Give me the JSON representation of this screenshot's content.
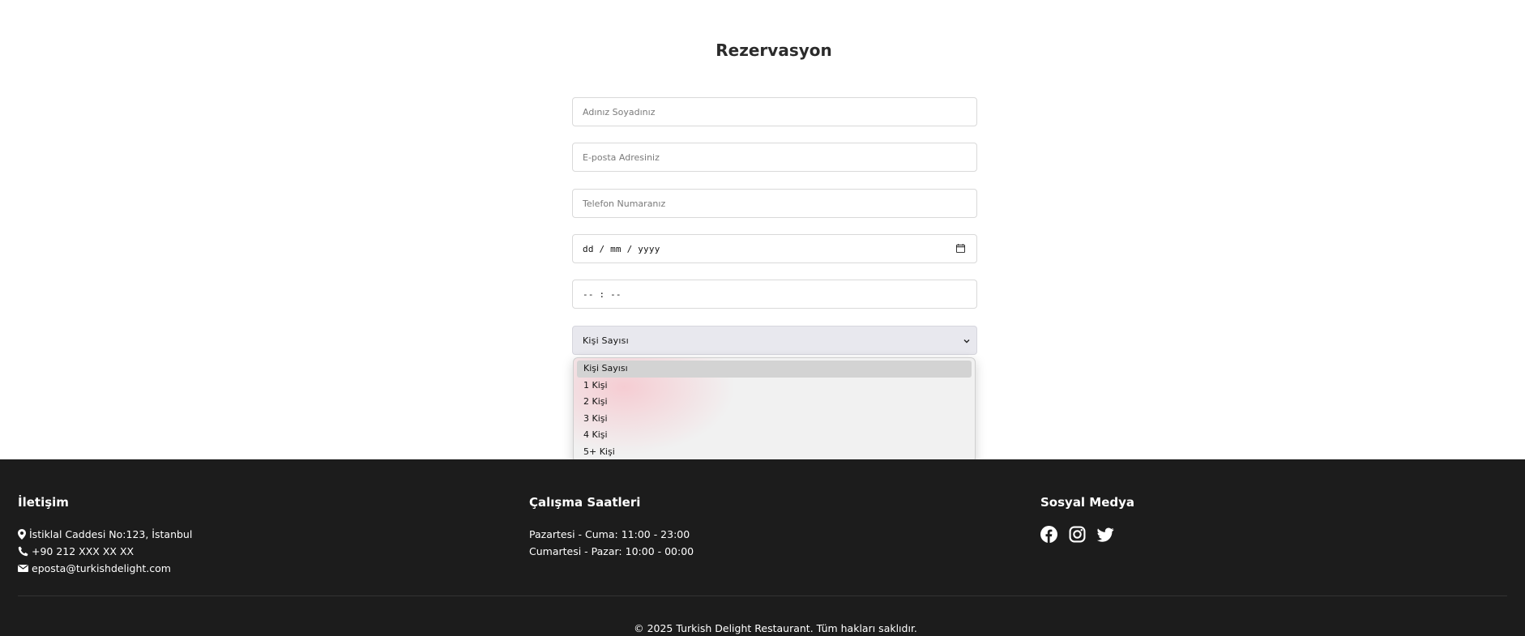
{
  "reservation": {
    "title": "Rezervasyon",
    "name_placeholder": "Adınız Soyadınız",
    "email_placeholder": "E-posta Adresiniz",
    "phone_placeholder": "Telefon Numaranız",
    "date_value": "dd / mm / yyyy",
    "time_value": "-- : --",
    "guests_selected": "Kişi Sayısı",
    "guests_options": [
      "Kişi Sayısı",
      "1 Kişi",
      "2 Kişi",
      "3 Kişi",
      "4 Kişi",
      "5+ Kişi"
    ]
  },
  "footer": {
    "contact": {
      "heading": "İletişim",
      "address": "İstiklal Caddesi No:123, İstanbul",
      "phone": "+90 212 XXX XX XX",
      "email": "eposta@turkishdelight.com"
    },
    "hours": {
      "heading": "Çalışma Saatleri",
      "weekdays": "Pazartesi - Cuma: 11:00 - 23:00",
      "weekend": "Cumartesi - Pazar: 10:00 - 00:00"
    },
    "social": {
      "heading": "Sosyal Medya",
      "icons": [
        "facebook-icon",
        "instagram-icon",
        "twitter-icon"
      ]
    },
    "copyright": "© 2025 Turkish Delight Restaurant. Tüm hakları saklıdır."
  }
}
